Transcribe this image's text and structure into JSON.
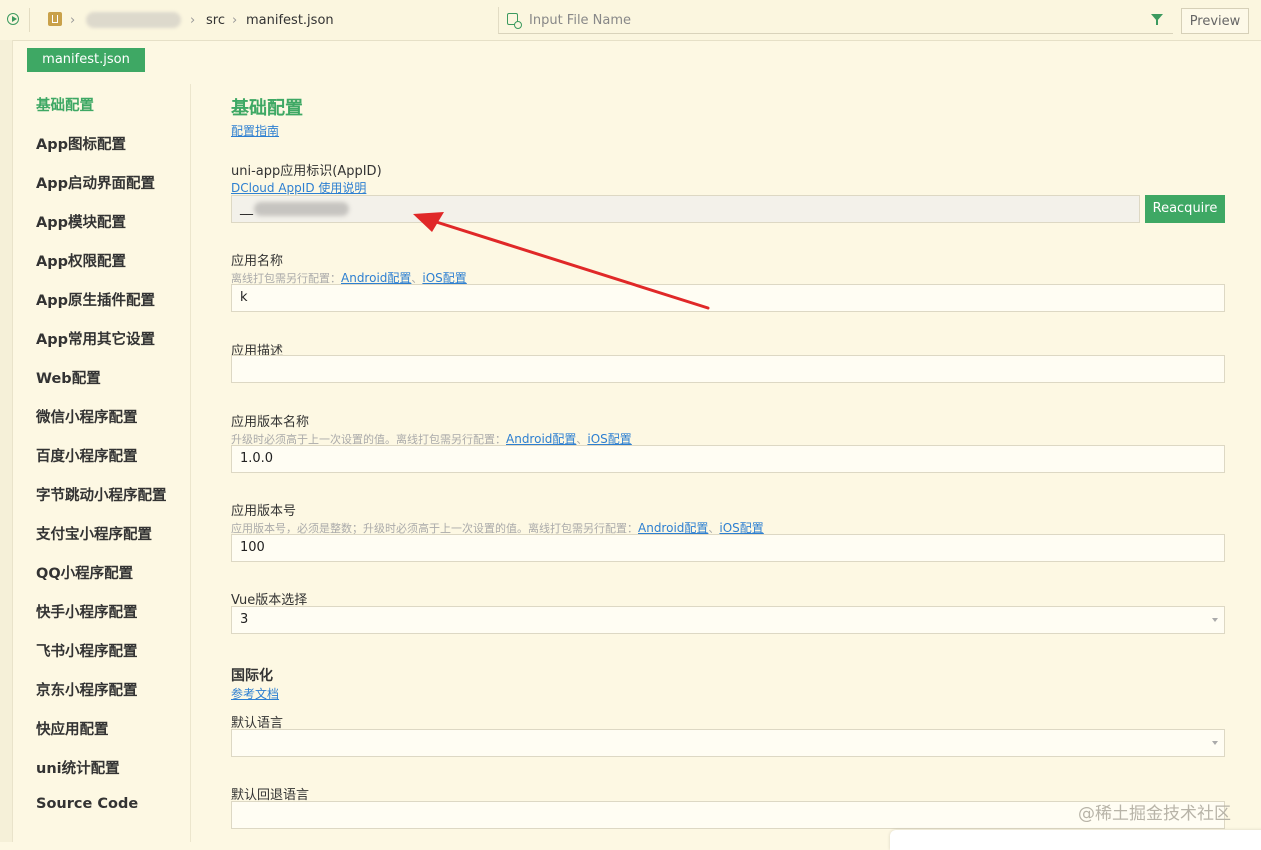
{
  "topbar": {
    "breadcrumb": [
      "src",
      "manifest.json"
    ],
    "search_placeholder": "Input File Name",
    "preview_label": "Preview"
  },
  "file_tab": "manifest.json",
  "sidebar": {
    "items": [
      {
        "label": "基础配置",
        "active": true
      },
      {
        "label": "App图标配置"
      },
      {
        "label": "App启动界面配置"
      },
      {
        "label": "App模块配置"
      },
      {
        "label": "App权限配置"
      },
      {
        "label": "App原生插件配置"
      },
      {
        "label": "App常用其它设置"
      },
      {
        "label": "Web配置"
      },
      {
        "label": "微信小程序配置"
      },
      {
        "label": "百度小程序配置"
      },
      {
        "label": "字节跳动小程序配置"
      },
      {
        "label": "支付宝小程序配置"
      },
      {
        "label": "QQ小程序配置"
      },
      {
        "label": "快手小程序配置"
      },
      {
        "label": "飞书小程序配置"
      },
      {
        "label": "京东小程序配置"
      },
      {
        "label": "快应用配置"
      },
      {
        "label": "uni统计配置"
      },
      {
        "label": "Source Code"
      }
    ]
  },
  "main": {
    "title": "基础配置",
    "guide_link": "配置指南",
    "appid": {
      "label": "uni-app应用标识(AppID)",
      "link": "DCloud AppID 使用说明",
      "value": "__",
      "button": "Reacquire"
    },
    "app_name": {
      "label": "应用名称",
      "hint": "离线打包需另行配置：",
      "link_android": "Android配置",
      "link_ios": "iOS配置",
      "value": "k"
    },
    "app_desc": {
      "label": "应用描述",
      "value": ""
    },
    "version_name": {
      "label": "应用版本名称",
      "hint": "升级时必须高于上一次设置的值。离线打包需另行配置：",
      "link_android": "Android配置",
      "link_ios": "iOS配置",
      "value": "1.0.0"
    },
    "version_code": {
      "label": "应用版本号",
      "hint": "应用版本号，必须是整数；升级时必须高于上一次设置的值。离线打包需另行配置：",
      "link_android": "Android配置",
      "link_ios": "iOS配置",
      "value": "100"
    },
    "vue_version": {
      "label": "Vue版本选择",
      "value": "3"
    },
    "i18n": {
      "title": "国际化",
      "link": "参考文档",
      "default_lang_label": "默认语言",
      "default_lang_value": "",
      "fallback_lang_label": "默认回退语言",
      "fallback_lang_value": ""
    }
  },
  "watermark": "@稀土掘金技术社区",
  "colors": {
    "accent": "#3ea864",
    "link": "#2d7fd1",
    "background": "#fdf8e3",
    "annotation_arrow": "#e02828"
  }
}
